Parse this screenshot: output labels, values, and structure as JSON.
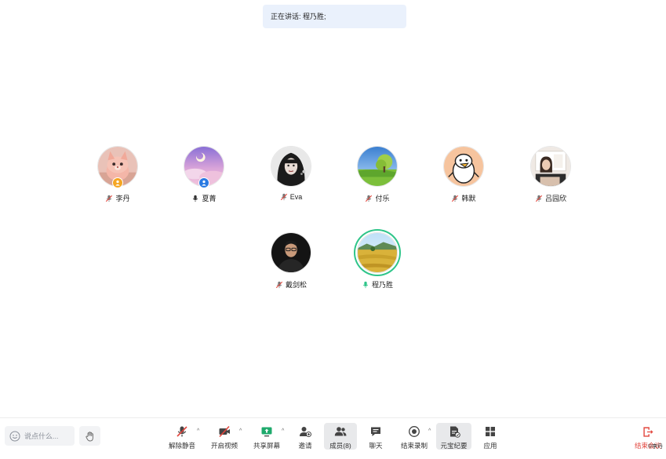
{
  "banner": {
    "speaking_text": "正在讲话: 程乃胜;"
  },
  "participants": [
    {
      "name": "李丹",
      "mic": "muted",
      "role": "host",
      "avatar": "pink-plush-cat",
      "badge_color": "#f5a623"
    },
    {
      "name": "夏菁",
      "mic": "unmuted",
      "role": "cohost",
      "avatar": "purple-sky",
      "badge_color": "#2a7ae2"
    },
    {
      "name": "Eva",
      "mic": "muted",
      "role": "member",
      "avatar": "dark-portrait"
    },
    {
      "name": "付乐",
      "mic": "muted",
      "role": "member",
      "avatar": "green-field-tree"
    },
    {
      "name": "韩默",
      "mic": "muted",
      "role": "member",
      "avatar": "cartoon-penguin"
    },
    {
      "name": "吕园欣",
      "mic": "muted",
      "role": "member",
      "avatar": "room-selfie"
    },
    {
      "name": "戴剑松",
      "mic": "muted",
      "role": "member",
      "avatar": "man-glasses-dark"
    },
    {
      "name": "程乃胜",
      "mic": "speaking",
      "role": "member",
      "avatar": "golden-rice-field",
      "active_speaker": true
    }
  ],
  "toolbar": {
    "chat_placeholder": "说点什么...",
    "items": [
      {
        "label": "解除静音",
        "icon": "mic-muted-icon",
        "has_caret": true
      },
      {
        "label": "开启视频",
        "icon": "video-off-icon",
        "has_caret": true
      },
      {
        "label": "共享屏幕",
        "icon": "share-screen-icon",
        "has_caret": true
      },
      {
        "label": "邀请",
        "icon": "invite-user-icon",
        "has_caret": false
      },
      {
        "label": "成员(8)",
        "icon": "members-icon",
        "has_caret": false,
        "active": true
      },
      {
        "label": "聊天",
        "icon": "chat-icon",
        "has_caret": false
      },
      {
        "label": "结束录制",
        "icon": "record-icon",
        "has_caret": true
      },
      {
        "label": "元宝纪要",
        "icon": "ai-notes-icon",
        "has_caret": false,
        "active": true
      },
      {
        "label": "应用",
        "icon": "apps-icon",
        "has_caret": false
      }
    ],
    "end_label": "结束会议",
    "end_color": "#e2463d"
  },
  "watermark": "©李丹",
  "colors": {
    "speaking_ring": "#2fc58a",
    "banner_bg": "#eaf1fc",
    "muted_red": "#e2463d"
  }
}
